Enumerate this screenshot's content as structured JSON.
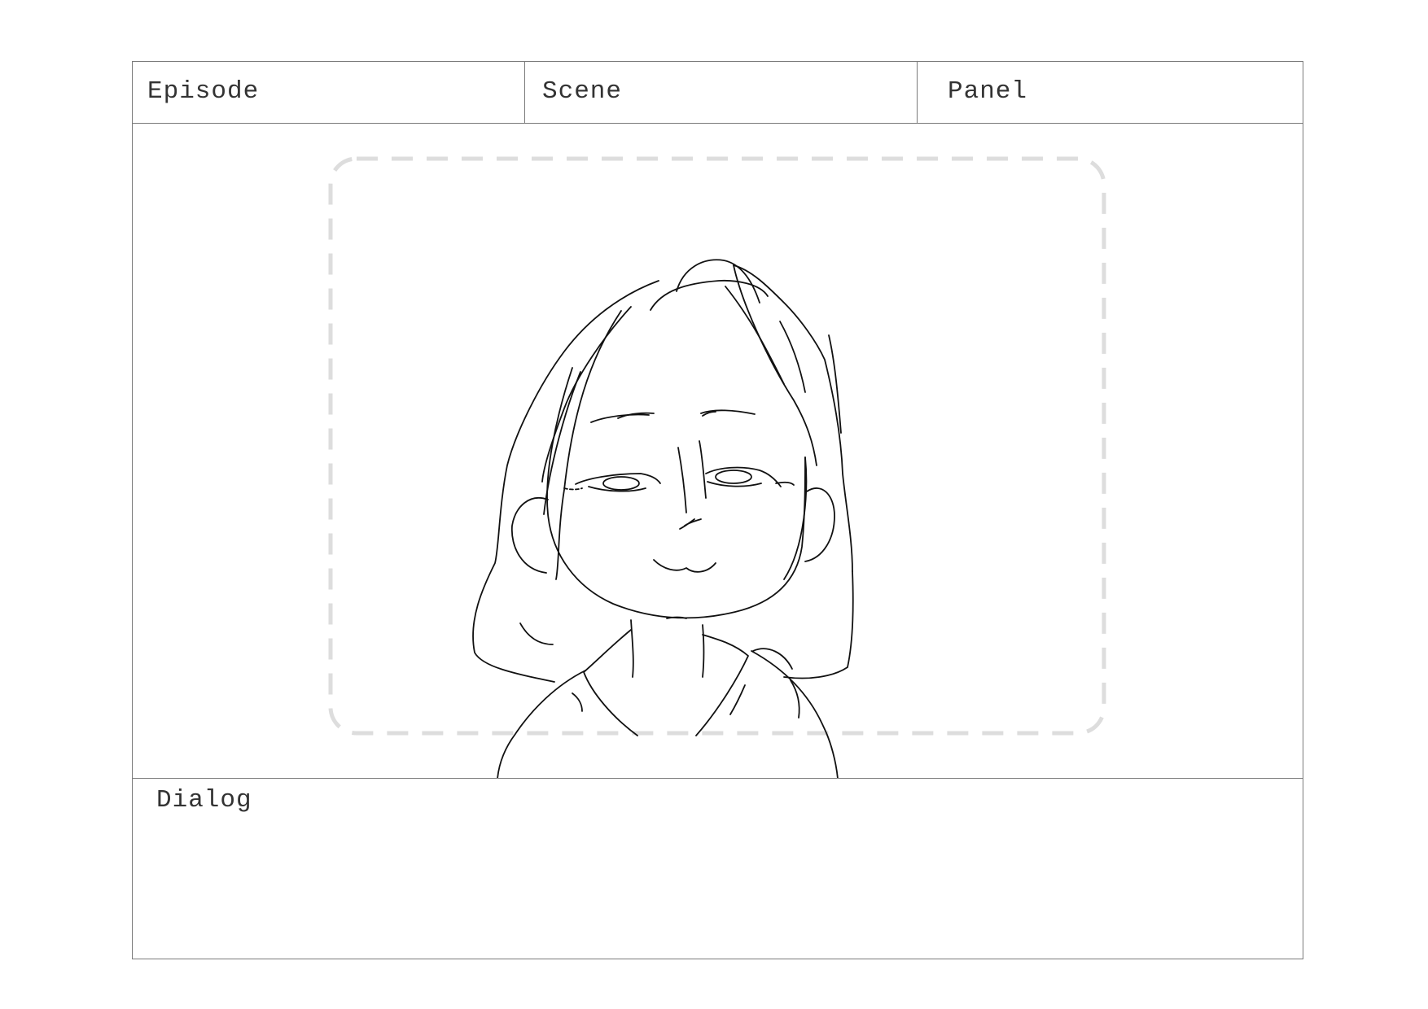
{
  "storyboard": {
    "episode_label": "Episode",
    "scene_label": "Scene",
    "panel_label": "Panel",
    "dialog_label": "Dialog"
  },
  "colors": {
    "frame_border": "#7a7a7a",
    "safe_area_dash": "#dddddd",
    "sketch_line": "#111111"
  }
}
